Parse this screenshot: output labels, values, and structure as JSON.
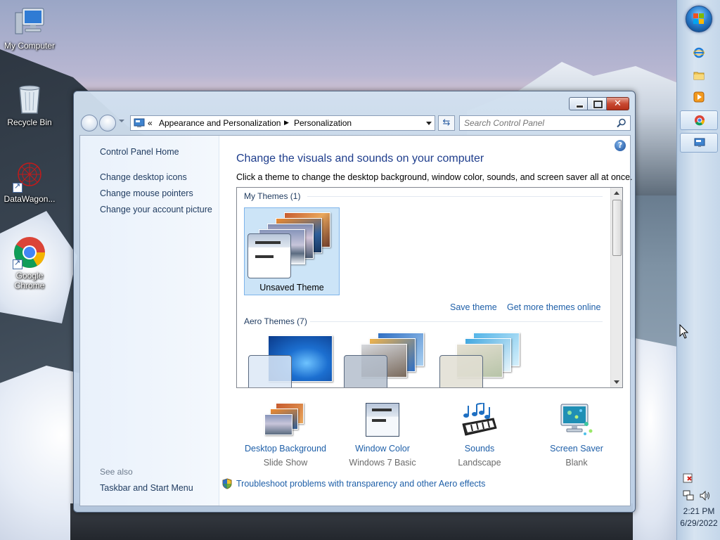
{
  "desktop": {
    "icons": [
      {
        "label": "My Computer"
      },
      {
        "label": "Recycle Bin"
      },
      {
        "label": "DataWagon..."
      },
      {
        "label": "Google Chrome"
      }
    ]
  },
  "window": {
    "address": {
      "overflow": "«",
      "crumb1": "Appearance and Personalization",
      "crumb2": "Personalization"
    },
    "search_placeholder": "Search Control Panel",
    "left_pane": {
      "home": "Control Panel Home",
      "links": [
        "Change desktop icons",
        "Change mouse pointers",
        "Change your account picture"
      ],
      "see_also_header": "See also",
      "see_also": [
        "Taskbar and Start Menu"
      ]
    },
    "main": {
      "title": "Change the visuals and sounds on your computer",
      "subtitle": "Click a theme to change the desktop background, window color, sounds, and screen saver all at once.",
      "my_themes_header": "My Themes (1)",
      "unsaved_theme": "Unsaved Theme",
      "save_theme": "Save theme",
      "get_more": "Get more themes online",
      "aero_themes_header": "Aero Themes (7)"
    },
    "bottom": [
      {
        "label": "Desktop Background",
        "value": "Slide Show"
      },
      {
        "label": "Window Color",
        "value": "Windows 7 Basic"
      },
      {
        "label": "Sounds",
        "value": "Landscape"
      },
      {
        "label": "Screen Saver",
        "value": "Blank"
      }
    ],
    "troubleshoot": "Troubleshoot problems with transparency and other Aero effects"
  },
  "taskbar": {
    "time": "2:21 PM",
    "date": "6/29/2022"
  }
}
